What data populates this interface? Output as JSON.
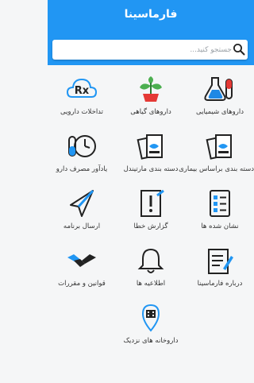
{
  "header": {
    "title": "فارماسینا",
    "search_placeholder": "جستجو کنید...",
    "search_value": ""
  },
  "menu": {
    "items": [
      {
        "label": "داروهای شیمیایی",
        "icon": "flask-pill-icon"
      },
      {
        "label": "داروهای گیاهی",
        "icon": "herb-plant-icon"
      },
      {
        "label": "تداخلات دارویی",
        "icon": "rx-cloud-icon"
      },
      {
        "label": "دسته بندی براساس بیماری",
        "icon": "category-cards-icon"
      },
      {
        "label": "دسته بندی مارتیندل",
        "icon": "category-book-icon"
      },
      {
        "label": "یادآور مصرف دارو",
        "icon": "pill-clock-icon"
      },
      {
        "label": "نشان شده ها",
        "icon": "bookmark-list-icon"
      },
      {
        "label": "گزارش خطا",
        "icon": "report-error-icon"
      },
      {
        "label": "ارسال برنامه",
        "icon": "send-app-icon"
      },
      {
        "label": "درباره فارماسینا",
        "icon": "about-notes-icon"
      },
      {
        "label": "اطلاعیه ها",
        "icon": "bell-icon"
      },
      {
        "label": "قوانین و مقررات",
        "icon": "handshake-icon"
      },
      {
        "label": "داروخانه های نزدیک",
        "icon": "pharmacy-location-icon"
      }
    ]
  },
  "colors": {
    "primary": "#2196f3",
    "icon_dark": "#222222",
    "accent_blue": "#1e88e5",
    "accent_green": "#4caf50",
    "accent_red": "#e53935"
  }
}
